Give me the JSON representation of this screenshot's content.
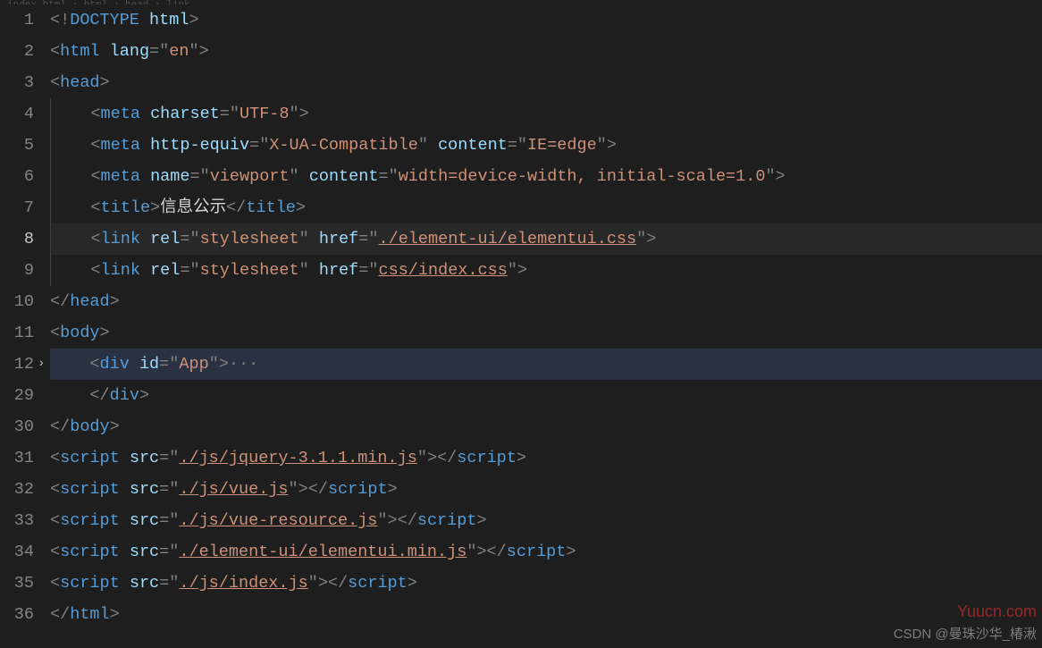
{
  "breadcrumb": "index.html › html › head › link",
  "lineNumbers": [
    "1",
    "2",
    "3",
    "4",
    "5",
    "6",
    "7",
    "8",
    "9",
    "10",
    "11",
    "12",
    "29",
    "30",
    "31",
    "32",
    "33",
    "34",
    "35",
    "36"
  ],
  "activeLineIndex": 7,
  "highlightLineIndex": 11,
  "foldedLineIndex": 11,
  "code": {
    "l1": {
      "doctype_open": "<!",
      "doctype_kw": "DOCTYPE",
      "sp": " ",
      "doctype_v": "html",
      "close": ">"
    },
    "l2": {
      "open": "<",
      "tag": "html",
      "sp": " ",
      "attr": "lang",
      "eq": "=",
      "q": "\"",
      "val": "en",
      "close": ">"
    },
    "l3": {
      "open": "<",
      "tag": "head",
      "close": ">"
    },
    "l4": {
      "open": "<",
      "tag": "meta",
      "sp": " ",
      "attr": "charset",
      "eq": "=",
      "q": "\"",
      "val": "UTF-8",
      "close": ">"
    },
    "l5": {
      "open": "<",
      "tag": "meta",
      "sp": " ",
      "attr1": "http-equiv",
      "eq": "=",
      "q": "\"",
      "val1": "X-UA-Compatible",
      "attr2": "content",
      "val2": "IE=edge",
      "close": ">"
    },
    "l6": {
      "open": "<",
      "tag": "meta",
      "sp": " ",
      "attr1": "name",
      "eq": "=",
      "q": "\"",
      "val1": "viewport",
      "attr2": "content",
      "val2": "width=device-width, initial-scale=1.0",
      "close": ">"
    },
    "l7": {
      "open": "<",
      "tag": "title",
      "close": ">",
      "text": "信息公示",
      "open2": "</",
      "close2": ">"
    },
    "l8": {
      "open": "<",
      "tag": "link",
      "sp": " ",
      "attr1": "rel",
      "eq": "=",
      "q": "\"",
      "val1": "stylesheet",
      "attr2": "href",
      "val2": "./element-ui/elementui.css",
      "close": ">"
    },
    "l9": {
      "open": "<",
      "tag": "link",
      "sp": " ",
      "attr1": "rel",
      "eq": "=",
      "q": "\"",
      "val1": "stylesheet",
      "attr2": "href",
      "val2": "css/index.css",
      "close": ">"
    },
    "l10": {
      "open": "</",
      "tag": "head",
      "close": ">"
    },
    "l11": {
      "open": "<",
      "tag": "body",
      "close": ">"
    },
    "l12": {
      "open": "<",
      "tag": "div",
      "sp": " ",
      "attr": "id",
      "eq": "=",
      "q": "\"",
      "val": "App",
      "close": ">",
      "dots": "···"
    },
    "l29": {
      "open": "</",
      "tag": "div",
      "close": ">"
    },
    "l30": {
      "open": "</",
      "tag": "body",
      "close": ">"
    },
    "l31": {
      "open": "<",
      "tag": "script",
      "sp": " ",
      "attr": "src",
      "eq": "=",
      "q": "\"",
      "val": "./js/jquery-3.1.1.min.js",
      "close": ">",
      "open2": "</",
      "close2": ">"
    },
    "l32": {
      "open": "<",
      "tag": "script",
      "sp": " ",
      "attr": "src",
      "eq": "=",
      "q": "\"",
      "val": "./js/vue.js",
      "close": ">",
      "open2": "</",
      "close2": ">"
    },
    "l33": {
      "open": "<",
      "tag": "script",
      "sp": " ",
      "attr": "src",
      "eq": "=",
      "q": "\"",
      "val": "./js/vue-resource.js",
      "close": ">",
      "open2": "</",
      "close2": ">"
    },
    "l34": {
      "open": "<",
      "tag": "script",
      "sp": " ",
      "attr": "src",
      "eq": "=",
      "q": "\"",
      "val": "./element-ui/elementui.min.js",
      "close": ">",
      "open2": "</",
      "close2": ">"
    },
    "l35": {
      "open": "<",
      "tag": "script",
      "sp": " ",
      "attr": "src",
      "eq": "=",
      "q": "\"",
      "val": "./js/index.js",
      "close": ">",
      "open2": "</",
      "close2": ">"
    },
    "l36": {
      "open": "</",
      "tag": "html",
      "close": ">"
    }
  },
  "watermark_site": "Yuucn.com",
  "watermark_author": "CSDN @曼珠沙华_椿湫"
}
